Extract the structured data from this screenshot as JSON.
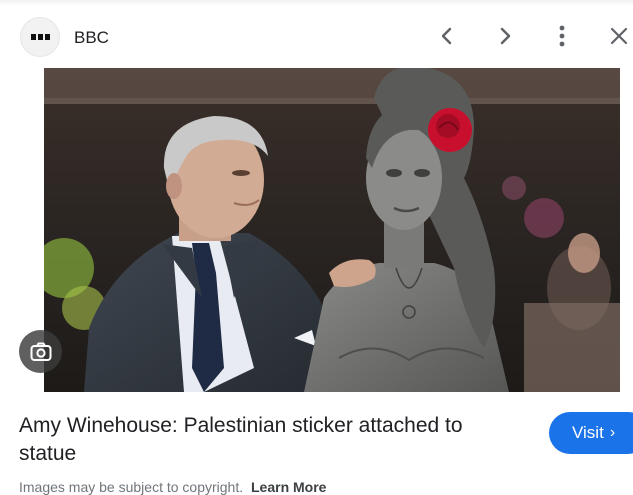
{
  "header": {
    "site_name": "BBC",
    "logo_icon": "bbc-logo-icon",
    "icons": [
      "back-chevron-icon",
      "forward-chevron-icon",
      "more-vert-icon",
      "close-icon"
    ]
  },
  "image": {
    "subject": "photo",
    "lens_icon": "google-lens-icon"
  },
  "result": {
    "title": "Amy Winehouse: Palestinian sticker attached to statue",
    "visit_label": "Visit",
    "copyright_text": "Images may be subject to copyright.",
    "learn_more_label": "Learn More"
  },
  "colors": {
    "accent": "#1a73e8",
    "text": "#202124",
    "muted": "#70757a"
  }
}
